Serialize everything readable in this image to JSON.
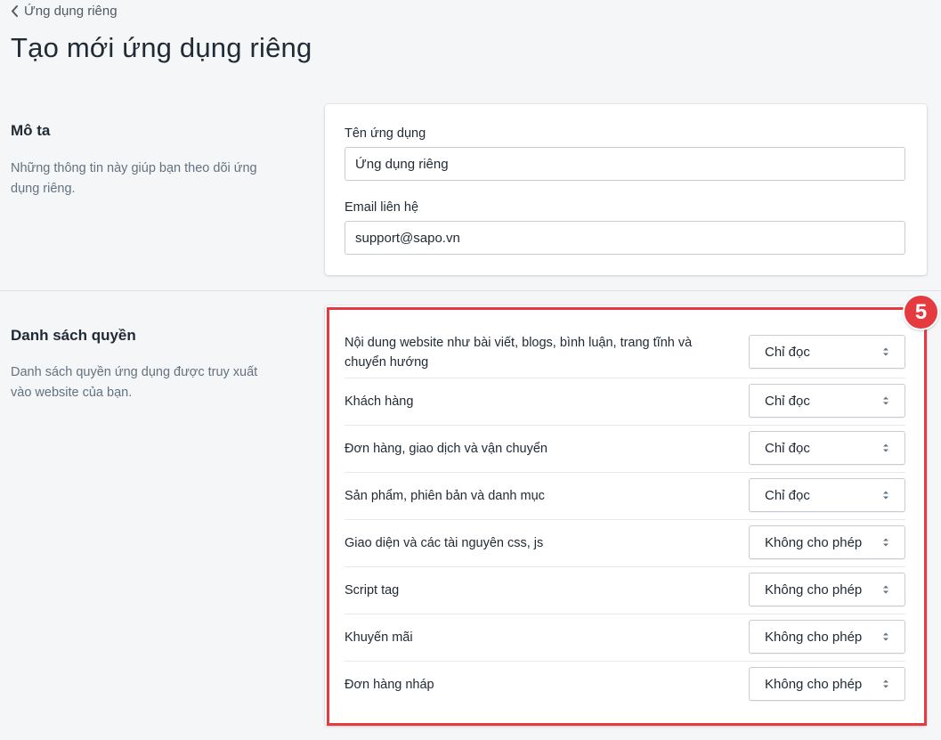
{
  "breadcrumb": {
    "label": "Ứng dụng riêng",
    "icon": "chevron-left-icon"
  },
  "page_title": "Tạo mới ứng dụng riêng",
  "description_section": {
    "title": "Mô ta",
    "desc": "Những thông tin này giúp bạn theo dõi ứng dụng riêng.",
    "fields": {
      "app_name": {
        "label": "Tên ứng dụng",
        "value": "Ứng dụng riêng"
      },
      "email": {
        "label": "Email liên hệ",
        "value": "support@sapo.vn"
      }
    }
  },
  "permissions_section": {
    "title": "Danh sách quyền",
    "desc": "Danh sách quyền ứng dụng được truy xuất vào website của bạn.",
    "step_badge": "5",
    "highlight_color": "#e53a40",
    "rows": [
      {
        "label": "Nội dung website như bài viết, blogs, bình luận, trang tĩnh và chuyển hướng",
        "value": "Chỉ đọc"
      },
      {
        "label": "Khách hàng",
        "value": "Chỉ đọc"
      },
      {
        "label": "Đơn hàng, giao dịch và vận chuyển",
        "value": "Chỉ đọc"
      },
      {
        "label": "Sản phẩm, phiên bản và danh mục",
        "value": "Chỉ đọc"
      },
      {
        "label": "Giao diện và các tài nguyên css, js",
        "value": "Không cho phép"
      },
      {
        "label": "Script tag",
        "value": "Không cho phép"
      },
      {
        "label": "Khuyến mãi",
        "value": "Không cho phép"
      },
      {
        "label": "Đơn hàng nháp",
        "value": "Không cho phép"
      }
    ]
  }
}
